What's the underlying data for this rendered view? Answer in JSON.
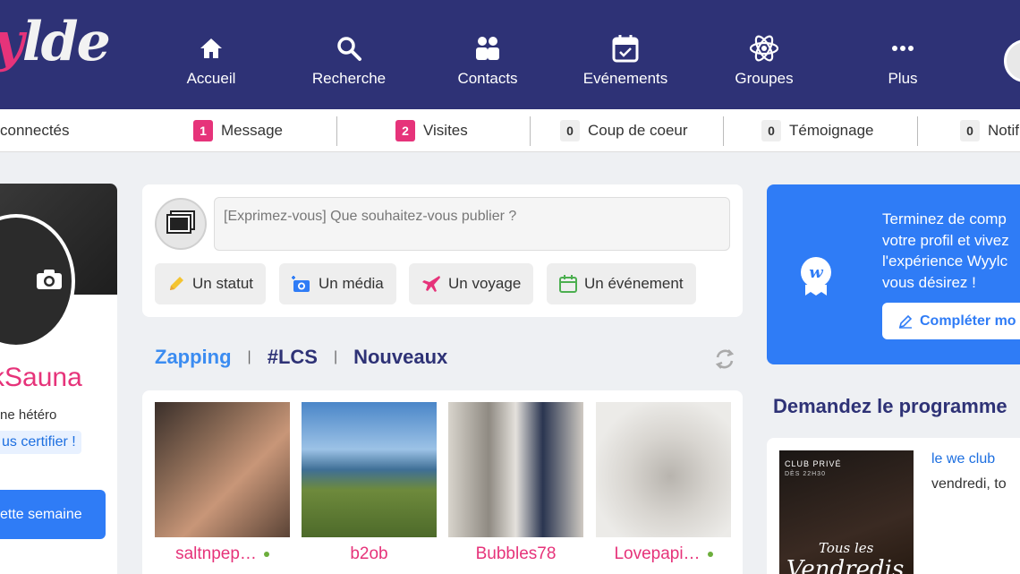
{
  "brand": {
    "logo_pink": "y",
    "logo_white": "lde"
  },
  "nav": {
    "items": [
      {
        "label": "Accueil",
        "icon": "home-icon"
      },
      {
        "label": "Recherche",
        "icon": "search-icon"
      },
      {
        "label": "Contacts",
        "icon": "contacts-icon"
      },
      {
        "label": "Evénements",
        "icon": "calendar-icon"
      },
      {
        "label": "Groupes",
        "icon": "atom-icon"
      },
      {
        "label": "Plus",
        "icon": "more-icon"
      }
    ]
  },
  "stats": {
    "connected": "connectés",
    "message": {
      "count": "1",
      "label": "Message"
    },
    "visits": {
      "count": "2",
      "label": "Visites"
    },
    "crush": {
      "count": "0",
      "label": "Coup de coeur"
    },
    "testimony": {
      "count": "0",
      "label": "Témoignage"
    },
    "notif": {
      "count": "0",
      "label": "Notif"
    }
  },
  "profile": {
    "username": "kSauna",
    "type": "ne hétéro",
    "certify": "us certifier !",
    "week_button": "ette semaine"
  },
  "composer": {
    "placeholder": "[Exprimez-vous] Que souhaitez-vous publier ?",
    "actions": {
      "status": "Un statut",
      "media": "Un média",
      "trip": "Un voyage",
      "event": "Un événement"
    }
  },
  "tabs": {
    "zapping": "Zapping",
    "lcs": "#LCS",
    "new": "Nouveaux",
    "sep": "|"
  },
  "cards": [
    {
      "name": "saltnpep…",
      "online": true
    },
    {
      "name": "b2ob",
      "online": false
    },
    {
      "name": "Bubbles78",
      "online": false
    },
    {
      "name": "Lovepapi…",
      "online": true
    }
  ],
  "promo": {
    "line1": "Terminez de comp",
    "line2": "votre profil et vivez",
    "line3": "l'expérience Wyylc",
    "line4": "vous désirez !",
    "button": "Compléter mo"
  },
  "programme": {
    "title": "Demandez le programme",
    "event_name": "le we club",
    "event_date": "vendredi, to",
    "poster_club": "CLUB PRIVÉ",
    "poster_hour": "DÈS 22H30",
    "poster_script": "Vendredis",
    "poster_script_top": "Tous les"
  },
  "colors": {
    "nav": "#2e3276",
    "pink": "#e6337a",
    "blue": "#2f7cf6"
  }
}
